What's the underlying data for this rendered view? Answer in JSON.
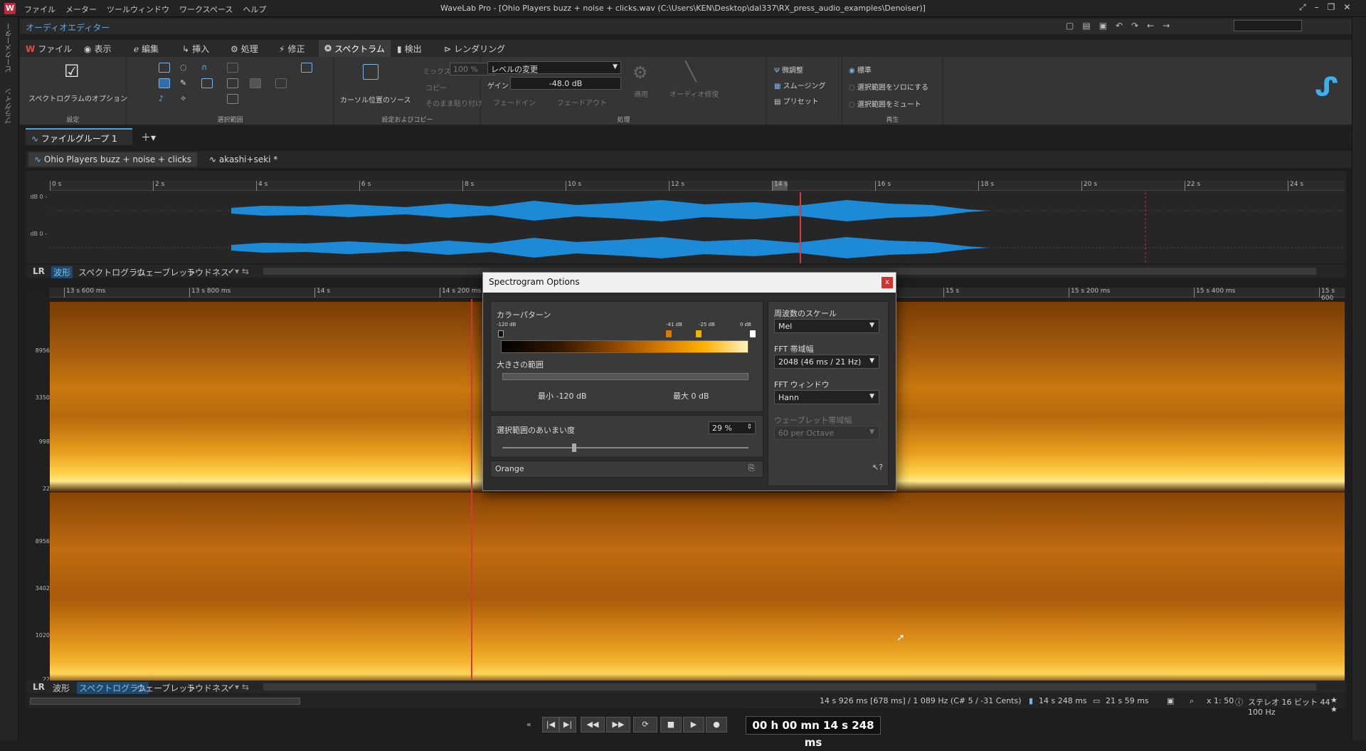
{
  "app": {
    "title": "WaveLab Pro - [Ohio Players buzz + noise + clicks.wav (C:\\Users\\KEN\\Desktop\\dal337\\RX_press_audio_examples\\Denoiser)]",
    "menu": [
      "ファイル",
      "メーター",
      "ツールウィンドウ",
      "ワークスペース",
      "ヘルプ"
    ],
    "icon_letter": "W"
  },
  "sidebar": {
    "labels": [
      "ピークメーター",
      "プラグイン"
    ]
  },
  "editor": {
    "label": "オーディオエディター"
  },
  "ribbon_tabs": [
    {
      "label": "ファイル"
    },
    {
      "label": "表示"
    },
    {
      "label": "編集"
    },
    {
      "label": "挿入"
    },
    {
      "label": "処理"
    },
    {
      "label": "修正"
    },
    {
      "label": "スペクトラム"
    },
    {
      "label": "検出"
    },
    {
      "label": "レンダリング"
    }
  ],
  "ribbon": {
    "spectrogram_options": "スペクトログラムのオプション",
    "group_settings": "設定",
    "group_selection": "選択範囲",
    "cursor_source": "カーソル位置のソース",
    "mix": "ミックス",
    "mix_value": "100 %",
    "copy": "コピー",
    "paste_as_is": "そのまま貼り付け",
    "group_source_copy": "設定およびコピー",
    "level_change": "レベルの変更",
    "gain_label": "ゲイン",
    "gain_value": "-48.0 dB",
    "fade_in": "フェードイン",
    "fade_out": "フェードアウト",
    "apply": "適用",
    "audio_repair": "オーディオ修復",
    "group_process": "処理",
    "fine_adjust": "微調整",
    "smoothing": "スムージング",
    "preset": "プリセット",
    "play_normal": "標準",
    "play_solo": "選択範囲をソロにする",
    "play_mute": "選択範囲をミュート",
    "group_playback": "再生"
  },
  "file_group": {
    "tab": "ファイルグループ 1"
  },
  "file_tabs": [
    {
      "label": "Ohio Players buzz + noise + clicks"
    },
    {
      "label": "akashi+seki *"
    }
  ],
  "overview": {
    "ruler_ticks": [
      "0 s",
      "2 s",
      "4 s",
      "6 s",
      "8 s",
      "10 s",
      "12 s",
      "14 s",
      "16 s",
      "18 s",
      "20 s",
      "22 s",
      "24 s"
    ],
    "db_labels": [
      "dB 0 -",
      "dB 0 -"
    ]
  },
  "mode_bar_top": {
    "lr": "LR",
    "items": [
      "波形",
      "スペクトログラム",
      "ウェーブレット",
      "ラウドネス"
    ],
    "active": "波形"
  },
  "mode_bar_bottom": {
    "lr": "LR",
    "items": [
      "波形",
      "スペクトログラム",
      "ウェーブレット",
      "ラウドネス"
    ],
    "active": "スペクトログラム"
  },
  "spec_ruler": [
    "13 s 600 ms",
    "13 s 800 ms",
    "14 s",
    "14 s 200 ms",
    "15 s",
    "15 s 200 ms",
    "15 s 400 ms",
    "15 s 600"
  ],
  "spec_yaxis": {
    "ch1": [
      "8956",
      "3350",
      "998",
      "22"
    ],
    "ch2": [
      "8956",
      "3402",
      "1020",
      "22"
    ]
  },
  "status": {
    "cursor_info": "14 s 926 ms [678 ms] / 1 089 Hz (C# 5 / -31 Cents)",
    "position": "14 s 248 ms",
    "length": "21 s 59 ms",
    "zoom": "x 1: 50",
    "format": "ステレオ 16 ビット 44 100 Hz"
  },
  "transport": {
    "timecode": "00 h 00 mn 14 s 248 ms"
  },
  "dialog": {
    "title": "Spectrogram Options",
    "color_pattern": "カラーパターン",
    "markers": [
      {
        "label": "-120 dB",
        "color": "#111111",
        "position": 0
      },
      {
        "label": "-41 dB",
        "color": "#e07800",
        "position": 0.66
      },
      {
        "label": "-25 dB",
        "color": "#f0b400",
        "position": 0.79
      },
      {
        "label": "0 dB",
        "color": "#ffffff",
        "position": 1
      }
    ],
    "magnitude_range": "大きさの範囲",
    "min_label": "最小 -120 dB",
    "max_label": "最大 0 dB",
    "selection_blur": "選択範囲のあいまい度",
    "blur_value": "29 %",
    "blur_fraction": 0.29,
    "preset": "Orange",
    "freq_scale_label": "周波数のスケール",
    "freq_scale": "Mel",
    "fft_size_label": "FFT 帯域幅",
    "fft_size": "2048   (46 ms / 21 Hz)",
    "fft_window_label": "FFT ウィンドウ",
    "fft_window": "Hann",
    "wavelet_label": "ウェーブレット帯域幅",
    "wavelet_value": "60 per Octave"
  }
}
